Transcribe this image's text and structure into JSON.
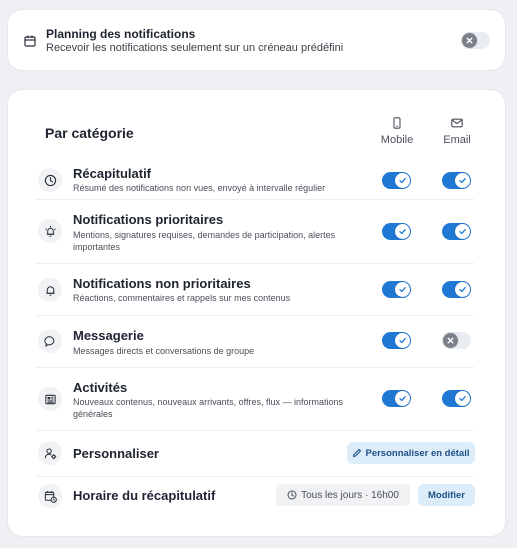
{
  "planning": {
    "title": "Planning des notifications",
    "description": "Recevoir les notifications seulement sur un créneau prédéfini",
    "enabled": false
  },
  "category": {
    "title": "Par catégorie",
    "columns": {
      "mobile": "Mobile",
      "email": "Email"
    },
    "rows": [
      {
        "title": "Récapitulatif",
        "description": "Résumé des notifications non vues, envoyé à intervalle régulier",
        "icon": "clock-icon",
        "mobile": true,
        "email": true
      },
      {
        "title": "Notifications prioritaires",
        "description": "Mentions, signatures requises, demandes de participation, alertes importantes",
        "icon": "alert-bell-icon",
        "mobile": true,
        "email": true
      },
      {
        "title": "Notifications non prioritaires",
        "description": "Réactions, commentaires et rappels sur mes contenus",
        "icon": "bell-icon",
        "mobile": true,
        "email": true
      },
      {
        "title": "Messagerie",
        "description": "Messages directs et conversations de groupe",
        "icon": "chat-icon",
        "mobile": true,
        "email": false
      },
      {
        "title": "Activités",
        "description": "Nouveaux contenus, nouveaux arrivants, offres, flux — informations générales",
        "icon": "newspaper-icon",
        "mobile": true,
        "email": true
      }
    ]
  },
  "customize": {
    "title": "Personnaliser",
    "button": "Personnaliser en détail"
  },
  "schedule": {
    "title": "Horaire du récapitulatif",
    "value": "Tous les jours · 16h00",
    "button": "Modifier"
  },
  "colors": {
    "toggle_on": "#1e78d4",
    "toggle_off": "#e9ecf0",
    "button_bg": "#dcecf9"
  }
}
